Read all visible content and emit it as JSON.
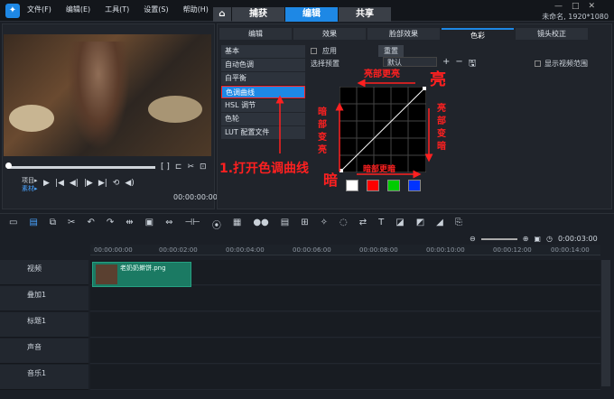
{
  "app": {
    "menu": [
      "文件(F)",
      "编辑(E)",
      "工具(T)",
      "设置(S)",
      "帮助(H)"
    ],
    "tabs": [
      "捕获",
      "编辑",
      "共享"
    ],
    "active_tab": "编辑",
    "doc_name": "未命名, 1920*1080"
  },
  "preview": {
    "project_label": "项目▸",
    "clip_label": "素材▸",
    "timecode": "00:00:00:00"
  },
  "options": {
    "tabs": [
      "编辑",
      "效果",
      "脸部效果",
      "色彩",
      "镜头校正"
    ],
    "active_tab": "色彩",
    "apply_label": "应用",
    "reset_label": "重置",
    "preset_label": "选择预置",
    "preset_value": "默认",
    "show_range": "显示视频范围",
    "side_items": [
      "基本",
      "自动色调",
      "白平衡",
      "色调曲线",
      "HSL 调节",
      "色轮",
      "LUT 配置文件"
    ],
    "active_side": "色调曲线"
  },
  "annotations": {
    "step1": "1.打开色调曲线",
    "bright_more": "亮部更亮",
    "bright": "亮",
    "bright_darker": "亮部变暗",
    "dark_brighter": "暗部变亮",
    "dark": "暗",
    "dark_more": "暗部更暗"
  },
  "swatches": [
    "#ffffff",
    "#ff0000",
    "#00cc00",
    "#0033ff"
  ],
  "timeline": {
    "ruler": [
      "00:00:00:00",
      "00:00:02:00",
      "00:00:04:00",
      "00:00:06:00",
      "00:00:08:00",
      "00:00:10:00",
      "00:00:12:00",
      "00:00:14:00"
    ],
    "tracks": [
      "视频",
      "叠加1",
      "标题1",
      "声音",
      "音乐1"
    ],
    "clip_name": "老奶奶擀饼.png",
    "zoom_time": "0:00:03:00"
  }
}
